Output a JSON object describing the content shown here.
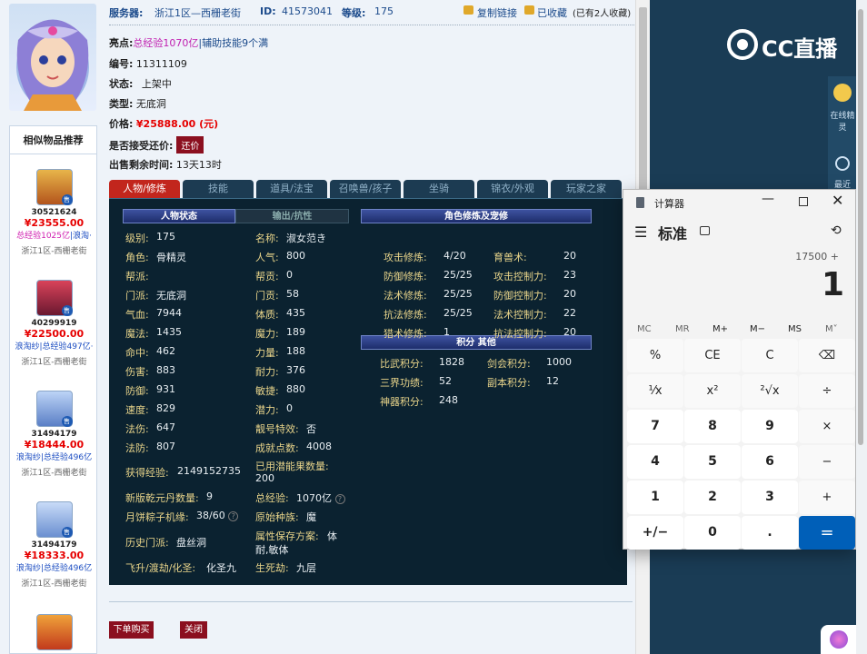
{
  "top": {
    "server_label": "服务器:",
    "server_value": "浙江1区—西栅老街",
    "id_label": "ID:",
    "id_value": "41573041",
    "level_label": "等级:",
    "level_value": "175",
    "copy_link": "复制链接",
    "favorited": "已收藏",
    "fav_count": "(已有2人收藏)"
  },
  "info": {
    "highlight_label": "亮点:",
    "highlight_value_1": "总经验1070亿",
    "highlight_value_2": "|辅助技能9个满",
    "number_label": "编号:",
    "number_value": "11311109",
    "status_label": "状态:",
    "status_value": "上架中",
    "type_label": "类型:",
    "type_value": "无底洞",
    "price_label": "价格:",
    "price_value": "¥25888.00 (元)",
    "bargain_label": "是否接受还价:",
    "bargain_button": "还价",
    "time_label": "出售剩余时间:",
    "time_value": "13天13时"
  },
  "tabs": [
    "人物/修炼",
    "技能",
    "道具/法宝",
    "召唤兽/孩子",
    "坐骑",
    "锦衣/外观",
    "玩家之家"
  ],
  "panel": {
    "hdr_status": "人物状态",
    "hdr_output": "输出/抗性",
    "hdr_cultivation": "角色修炼及宠修",
    "hdr_score": "积分 其他"
  },
  "stats_left": [
    {
      "k": "级别:",
      "v": "175"
    },
    {
      "k": "角色:",
      "v": "骨精灵"
    },
    {
      "k": "帮派:",
      "v": ""
    },
    {
      "k": "门派:",
      "v": "无底洞"
    },
    {
      "k": "气血:",
      "v": "7944"
    },
    {
      "k": "魔法:",
      "v": "1435"
    },
    {
      "k": "命中:",
      "v": "462"
    },
    {
      "k": "伤害:",
      "v": "883"
    },
    {
      "k": "防御:",
      "v": "931"
    },
    {
      "k": "速度:",
      "v": "829"
    },
    {
      "k": "法伤:",
      "v": "647"
    },
    {
      "k": "法防:",
      "v": "807"
    }
  ],
  "stats_mid": [
    {
      "k": "名称:",
      "v": "淑女范き"
    },
    {
      "k": "人气:",
      "v": "800"
    },
    {
      "k": "帮贡:",
      "v": "0"
    },
    {
      "k": "门贡:",
      "v": "58"
    },
    {
      "k": "体质:",
      "v": "435"
    },
    {
      "k": "魔力:",
      "v": "189"
    },
    {
      "k": "力量:",
      "v": "188"
    },
    {
      "k": "耐力:",
      "v": "376"
    },
    {
      "k": "敏捷:",
      "v": "880"
    },
    {
      "k": "潜力:",
      "v": "0"
    },
    {
      "k": "靓号特效:",
      "v": "否"
    },
    {
      "k": "成就点数:",
      "v": "4008"
    }
  ],
  "stats_extra": {
    "exp_label": "获得经验:",
    "exp_value": "2149152735",
    "used_label": "已用潜能果数量:",
    "used_value": "200",
    "qiankun_label": "新版乾元丹数量:",
    "qiankun_value": "9",
    "total_exp_label": "总经验:",
    "total_exp_value": "1070亿",
    "mooncake_label": "月饼粽子机缘:",
    "mooncake_value": "38/60",
    "race_label": "原始种族:",
    "race_value": "魔",
    "history_label": "历史门派:",
    "history_value": "盘丝洞",
    "attr_label": "属性保存方案:",
    "attr_value": "体",
    "attr_value_2": "耐,敏体",
    "feisheng_label": "飞升/渡劫/化圣:",
    "feisheng_value": "化圣九",
    "shengsi_label": "生死劫:",
    "shengsi_value": "九层"
  },
  "cultivation": [
    {
      "k1": "攻击修炼:",
      "v1": "4/20",
      "k2": "育兽术:",
      "v2": "20"
    },
    {
      "k1": "防御修炼:",
      "v1": "25/25",
      "k2": "攻击控制力:",
      "v2": "23"
    },
    {
      "k1": "法术修炼:",
      "v1": "25/25",
      "k2": "防御控制力:",
      "v2": "20"
    },
    {
      "k1": "抗法修炼:",
      "v1": "25/25",
      "k2": "法术控制力:",
      "v2": "22"
    },
    {
      "k1": "猎术修炼:",
      "v1": "1",
      "k2": "抗法控制力:",
      "v2": "20"
    }
  ],
  "scores": [
    {
      "k1": "比武积分:",
      "v1": "1828",
      "k2": "剑会积分:",
      "v2": "1000"
    },
    {
      "k1": "三界功绩:",
      "v1": "52",
      "k2": "副本积分:",
      "v2": "12"
    },
    {
      "k1": "神器积分:",
      "v1": "248",
      "k2": "",
      "v2": ""
    }
  ],
  "actions": {
    "buy": "下单购买",
    "close": "关闭"
  },
  "sidebar": {
    "title": "相似物品推荐",
    "badge": "售",
    "items": [
      {
        "id": "30521624",
        "price": "¥23555.00",
        "tag_hl": "总经验1025亿",
        "tag": "|浪淘·",
        "server": "浙江1区-西栅老街"
      },
      {
        "id": "40299919",
        "price": "¥22500.00",
        "tag_hl": "",
        "tag": "浪淘纱|总经验497亿·",
        "server": "浙江1区-西栅老街"
      },
      {
        "id": "31494179",
        "price": "¥18444.00",
        "tag_hl": "",
        "tag": "浪淘纱|总经验496亿",
        "server": "浙江1区-西栅老街"
      },
      {
        "id": "31494179",
        "price": "¥18333.00",
        "tag_hl": "",
        "tag": "浪淘纱|总经验496亿",
        "server": "浙江1区-西栅老街"
      }
    ]
  },
  "right": {
    "logo": "CC直播",
    "online_label": "在线精灵",
    "recent_label": "最近"
  },
  "calculator": {
    "title": "计算器",
    "mode": "标准",
    "expression": "17500 +",
    "display": "1",
    "memory": [
      "MC",
      "MR",
      "M+",
      "M−",
      "MS",
      "M˅"
    ],
    "keys": [
      [
        "%",
        "CE",
        "C",
        "⌫"
      ],
      [
        "¹⁄x",
        "x²",
        "²√x",
        "÷"
      ],
      [
        "7",
        "8",
        "9",
        "×"
      ],
      [
        "4",
        "5",
        "6",
        "−"
      ],
      [
        "1",
        "2",
        "3",
        "+"
      ],
      [
        "+/−",
        "0",
        ".",
        "="
      ]
    ]
  },
  "colors": {
    "accent": "#c2261d",
    "panel_bg": "#0b2230",
    "price": "#e60000",
    "calc_eq": "#005fb8"
  }
}
